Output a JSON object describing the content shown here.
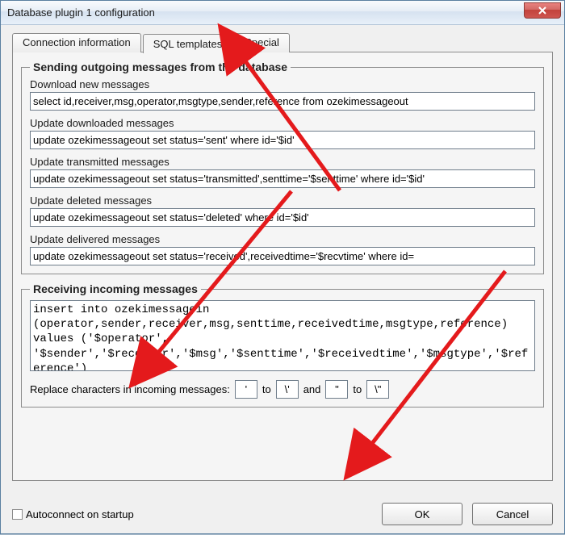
{
  "window": {
    "title": "Database plugin 1 configuration"
  },
  "tabs": {
    "connection": "Connection information",
    "sql": "SQL templates",
    "special": "Special",
    "active_index": 1
  },
  "outgoing": {
    "legend": "Sending outgoing messages from the database",
    "download_label": "Download new messages",
    "download_value": "select id,receiver,msg,operator,msgtype,sender,reference from ozekimessageout",
    "downloaded_label": "Update downloaded messages",
    "downloaded_value": "update ozekimessageout set status='sent' where id='$id'",
    "transmitted_label": "Update transmitted messages",
    "transmitted_value": "update ozekimessageout set status='transmitted',senttime='$senttime' where id='$id'",
    "deleted_label": "Update deleted messages",
    "deleted_value": "update ozekimessageout set status='deleted' where id='$id'",
    "delivered_label": "Update delivered messages",
    "delivered_value": "update ozekimessageout set status='received',receivedtime='$recvtime' where id="
  },
  "incoming": {
    "legend": "Receiving incoming messages",
    "insert_value": "insert into ozekimessagein (operator,sender,receiver,msg,senttime,receivedtime,msgtype,reference) values ('$operator', '$sender','$receiver','$msg','$senttime','$receivedtime','$msgtype','$reference')",
    "replace_label": "Replace characters in incoming messages:",
    "replace_from1": "'",
    "replace_to1": "\\'",
    "replace_and": "and",
    "replace_to_word": "to",
    "replace_from2": "\"",
    "replace_to2": "\\\""
  },
  "footer": {
    "autoconnect_label": "Autoconnect on startup",
    "autoconnect_checked": false,
    "ok": "OK",
    "cancel": "Cancel"
  }
}
